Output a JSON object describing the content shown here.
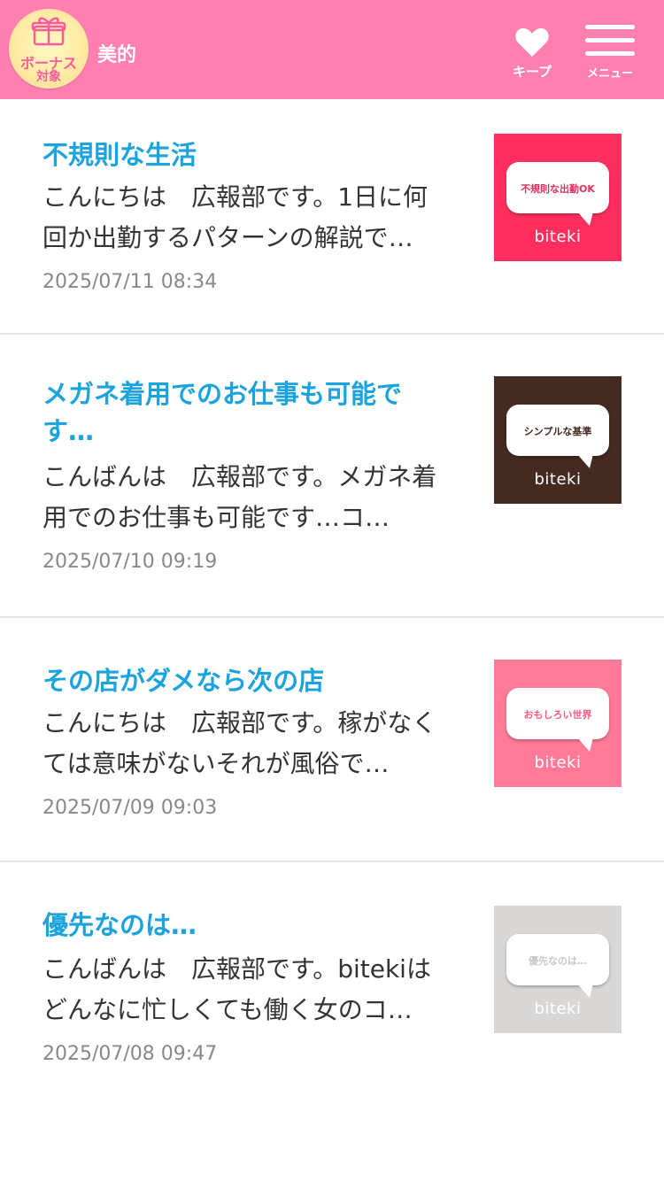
{
  "header": {
    "badge_line1": "ボーナス",
    "badge_line2": "対象",
    "site_name": "美的",
    "keep_label": "キープ",
    "menu_label": "メニュー",
    "bg_color": "#ff80b0"
  },
  "posts": [
    {
      "title": "不規則な生活",
      "body": "こんにちは　広報部です。1日に何回か出勤するパターンの解説で…",
      "date": "2025/07/11 08:34",
      "thumb_text": "不規則な出勤OK",
      "thumb_brand": "biteki",
      "thumb_bg": "#ff2e5e",
      "thumb_text_color": "#e2325f"
    },
    {
      "title": "メガネ着用でのお仕事も可能です…",
      "body": "こんばんは　広報部です。メガネ着用でのお仕事も可能です…コ…",
      "date": "2025/07/10 09:19",
      "thumb_text": "シンプルな基準",
      "thumb_brand": "biteki",
      "thumb_bg": "#452a21",
      "thumb_text_color": "#452a21"
    },
    {
      "title": "その店がダメなら次の店",
      "body": "こんにちは　広報部です。稼がなくては意味がないそれが風俗で…",
      "date": "2025/07/09 09:03",
      "thumb_text": "おもしろい世界",
      "thumb_brand": "biteki",
      "thumb_bg": "#ff7a96",
      "thumb_text_color": "#ff5a82"
    },
    {
      "title": "優先なのは…",
      "body": "こんばんは　広報部です。bitekiはどんなに忙しくても働く女のコ…",
      "date": "2025/07/08 09:47",
      "thumb_text": "優先なのは…",
      "thumb_brand": "biteki",
      "thumb_bg": "#d9d7d5",
      "thumb_text_color": "#c8c8c8"
    }
  ]
}
